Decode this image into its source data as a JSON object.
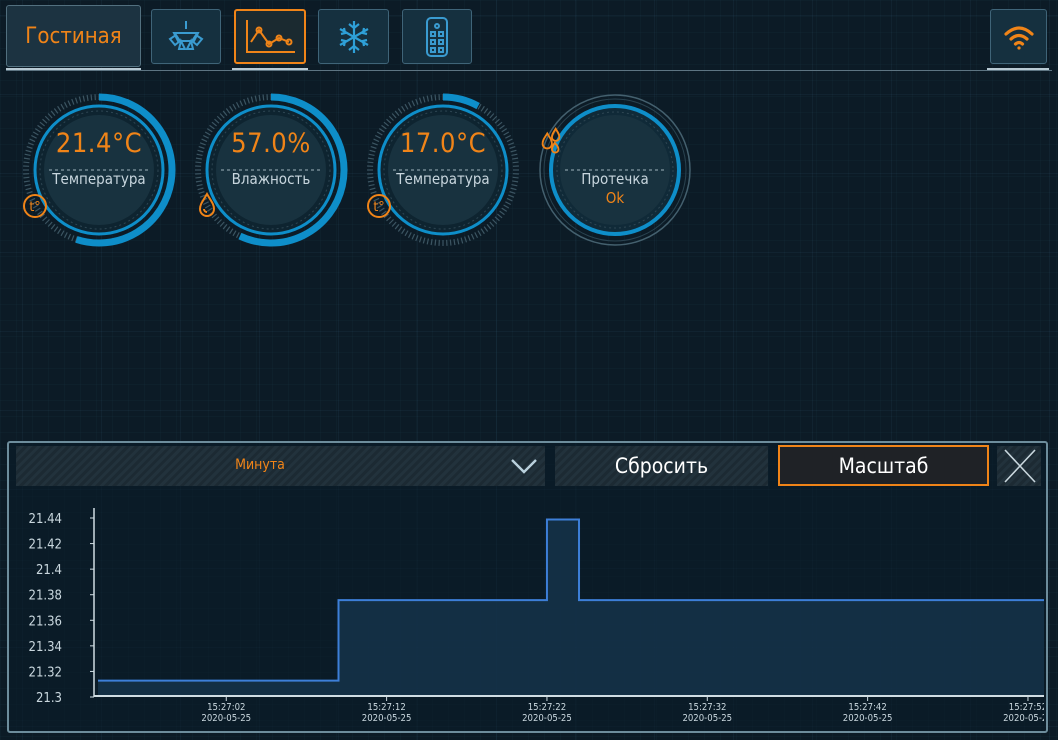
{
  "header": {
    "room_tab": "Гостиная",
    "icons": [
      "chandelier-icon",
      "chart-icon",
      "snowflake-icon",
      "remote-icon",
      "wifi-icon"
    ],
    "active_tab": "chart-icon"
  },
  "gauges": [
    {
      "value": "21.4°C",
      "label": "Температура",
      "icon": "thermometer-icon",
      "level": 0.55
    },
    {
      "value": "57.0%",
      "label": "Влажность",
      "icon": "drop-icon",
      "level": 0.57
    },
    {
      "value": "17.0°C",
      "label": "Температура",
      "icon": "thermometer-icon",
      "level": 0.08
    },
    {
      "label": "Протечка",
      "status": "Ok",
      "icon": "drops-icon"
    }
  ],
  "controls": {
    "interval": "Минута",
    "reset_label": "Сбросить",
    "scale_label": "Масштаб"
  },
  "colors": {
    "accent": "#f08418",
    "gauge": "#0e8ec9",
    "line": "#3d7fd8"
  },
  "chart_data": {
    "type": "line",
    "step": true,
    "yticks": [
      "21.44",
      "21.42",
      "21.4",
      "21.38",
      "21.36",
      "21.34",
      "21.32",
      "21.3"
    ],
    "ylim": [
      21.3,
      21.44
    ],
    "xticks": [
      {
        "time": "15:27:02",
        "date": "2020-05-25"
      },
      {
        "time": "15:27:12",
        "date": "2020-05-25"
      },
      {
        "time": "15:27:22",
        "date": "2020-05-25"
      },
      {
        "time": "15:27:32",
        "date": "2020-05-25"
      },
      {
        "time": "15:27:42",
        "date": "2020-05-25"
      },
      {
        "time": "15:27:52",
        "date": "2020-05-25"
      }
    ],
    "xlim": [
      "15:26:54",
      "15:27:53"
    ],
    "series": [
      {
        "points": [
          [
            "15:26:54",
            21.312
          ],
          [
            "15:27:09",
            21.312
          ],
          [
            "15:27:09",
            21.375
          ],
          [
            "15:27:22",
            21.375
          ],
          [
            "15:27:22",
            21.438
          ],
          [
            "15:27:24",
            21.438
          ],
          [
            "15:27:24",
            21.375
          ],
          [
            "15:27:53",
            21.375
          ]
        ]
      }
    ]
  }
}
